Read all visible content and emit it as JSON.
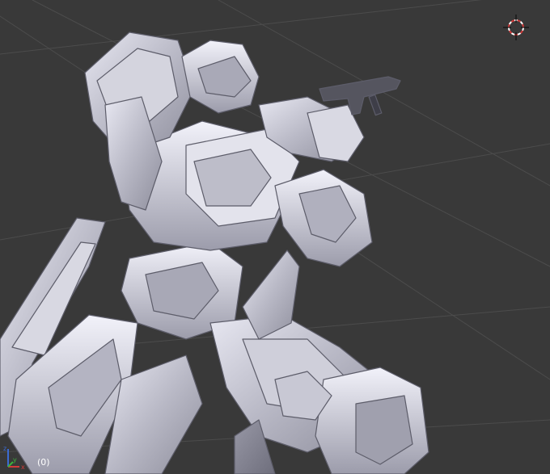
{
  "viewport": {
    "frame_label": "(0)",
    "background_color": "#393939",
    "grid_color": "#4a4a4a",
    "model_color": "#c4c4cc",
    "object_name": "mecha-model"
  },
  "cursor": {
    "icon": "3d-cursor-icon",
    "ring_color_a": "#d23b3b",
    "ring_color_b": "#ffffff"
  },
  "axes": {
    "icon": "axes-gizmo-icon",
    "x_label": "x",
    "y_label": "y",
    "z_label": "z",
    "x_color": "#d23b3b",
    "y_color": "#3bb33b",
    "z_color": "#3b6bd2"
  }
}
